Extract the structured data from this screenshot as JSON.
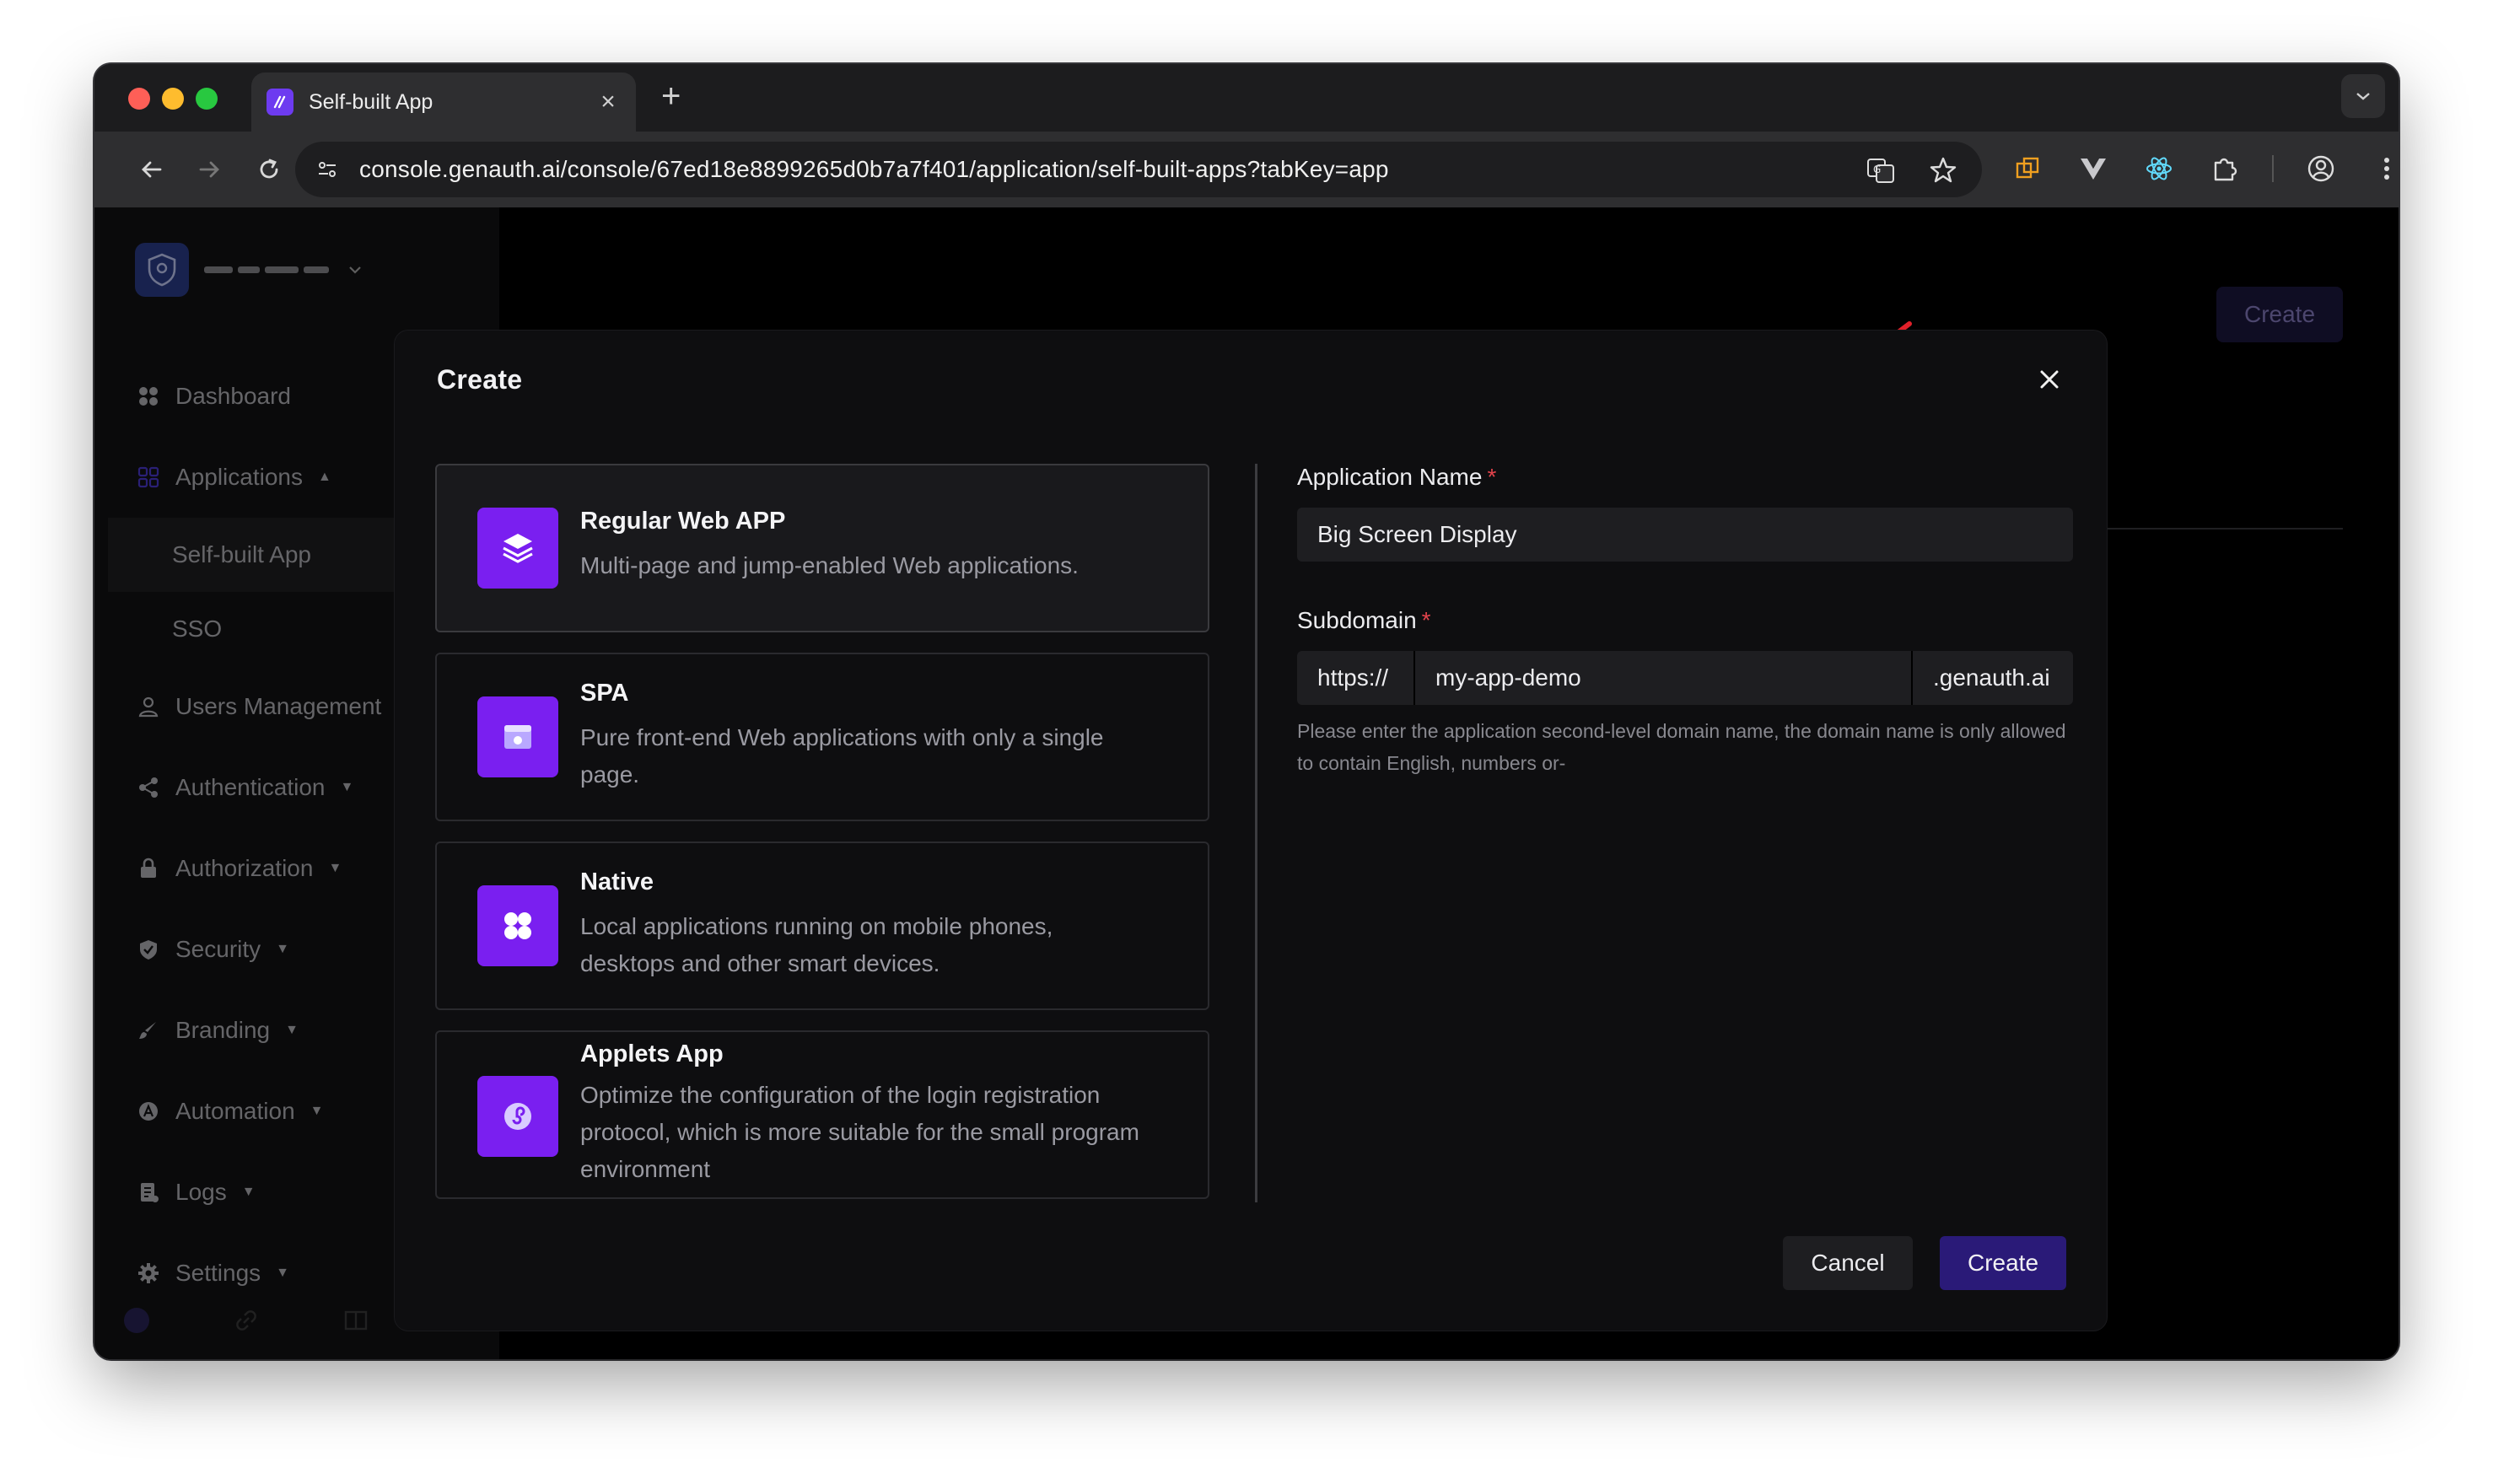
{
  "browser": {
    "tab_title": "Self-built App",
    "tab_close": "×",
    "new_tab": "+",
    "url": "console.genauth.ai/console/67ed18e8899265d0b7a7f401/application/self-built-apps?tabKey=app"
  },
  "sidebar": {
    "items": [
      {
        "label": "Dashboard",
        "icon": "dashboard-icon"
      },
      {
        "label": "Applications",
        "icon": "applications-icon",
        "caret": "▲"
      },
      {
        "label": "Users Management",
        "icon": "user-icon"
      },
      {
        "label": "Authentication",
        "icon": "share-icon",
        "caret": "▼"
      },
      {
        "label": "Authorization",
        "icon": "lock-icon",
        "caret": "▼"
      },
      {
        "label": "Security",
        "icon": "shield-icon",
        "caret": "▼"
      },
      {
        "label": "Branding",
        "icon": "brush-icon",
        "caret": "▼"
      },
      {
        "label": "Automation",
        "icon": "automation-icon",
        "caret": "▼"
      },
      {
        "label": "Logs",
        "icon": "logs-icon",
        "caret": "▼"
      },
      {
        "label": "Settings",
        "icon": "gear-icon",
        "caret": "▼"
      }
    ],
    "sub_items": [
      {
        "label": "Self-built App"
      },
      {
        "label": "SSO"
      }
    ]
  },
  "main": {
    "create_label": "Create"
  },
  "modal": {
    "title": "Create",
    "app_types": [
      {
        "title": "Regular Web APP",
        "description": "Multi-page and jump-enabled Web applications.",
        "icon": "layers-icon"
      },
      {
        "title": "SPA",
        "description": "Pure front-end Web applications with only a single page.",
        "icon": "browser-window-icon"
      },
      {
        "title": "Native",
        "description": "Local applications running on mobile phones, desktops and other smart devices.",
        "icon": "grid-icon"
      },
      {
        "title": "Applets App",
        "description": "Optimize the configuration of the login registration protocol, which is more suitable for the small program environment",
        "icon": "applet-icon"
      }
    ],
    "form": {
      "app_name_label": "Application Name",
      "app_name_value": "Big Screen Display",
      "subdomain_label": "Subdomain",
      "required_mark": "*",
      "subdomain_prefix": "https://",
      "subdomain_value": "my-app-demo",
      "subdomain_suffix": ".genauth.ai",
      "subdomain_help": "Please enter the application second-level domain name, the domain name is only allowed to contain English, numbers or-"
    },
    "cancel_label": "Cancel",
    "create_label": "Create"
  },
  "colors": {
    "accent": "#7a1ff0",
    "primary_button": "#2a1a78",
    "required": "#e2434c",
    "annotation_arrow": "#e0202a"
  }
}
